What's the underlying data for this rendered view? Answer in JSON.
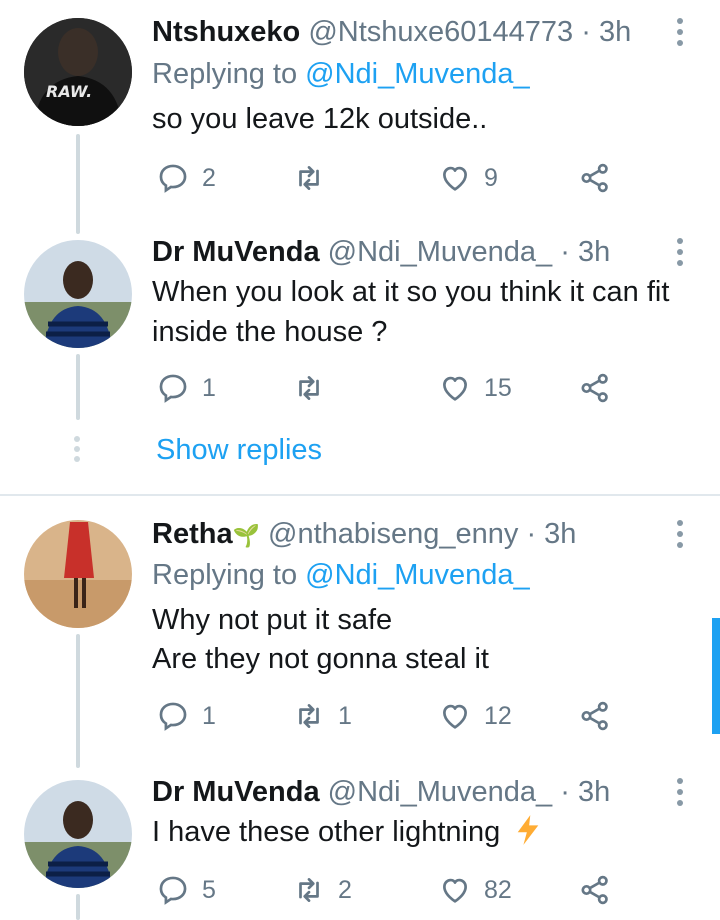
{
  "colors": {
    "accent": "#1da1f2",
    "muted": "#657786",
    "text": "#14171a",
    "divider": "#e1e8ed",
    "lightning": "#ffac33"
  },
  "tweets": [
    {
      "name": "Ntshuxeko",
      "handle": "@Ntshuxe60144773",
      "time": "· 3h",
      "replying_prefix": "Replying to",
      "replying_to": "@Ndi_Muvenda_",
      "lines": [
        "so you leave 12k outside.."
      ],
      "avatar_text": "RAW.",
      "counts": {
        "replies": "2",
        "retweets": "",
        "likes": "9"
      }
    },
    {
      "name": "Dr MuVenda",
      "handle": "@Ndi_Muvenda_",
      "time": "· 3h",
      "lines": [
        "When you look at it so you think it can fit",
        "inside the house ?"
      ],
      "counts": {
        "replies": "1",
        "retweets": "",
        "likes": "15"
      }
    },
    {
      "name": "Retha",
      "handle": "@nthabiseng_enny",
      "time": "· 3h",
      "replying_prefix": "Replying to",
      "replying_to": "@Ndi_Muvenda_",
      "lines": [
        "Why not put it safe",
        "Are they not gonna steal it"
      ],
      "counts": {
        "replies": "1",
        "retweets": "1",
        "likes": "12"
      }
    },
    {
      "name": "Dr MuVenda",
      "handle": "@Ndi_Muvenda_",
      "time": "· 3h",
      "lines": [
        "I have these other lightning"
      ],
      "counts": {
        "replies": "5",
        "retweets": "2",
        "likes": "82"
      }
    }
  ],
  "show_replies": "Show replies",
  "icons": [
    "reply-icon",
    "retweet-icon",
    "like-icon",
    "share-icon",
    "more-icon",
    "lightning-icon",
    "plant-emoji-icon"
  ]
}
